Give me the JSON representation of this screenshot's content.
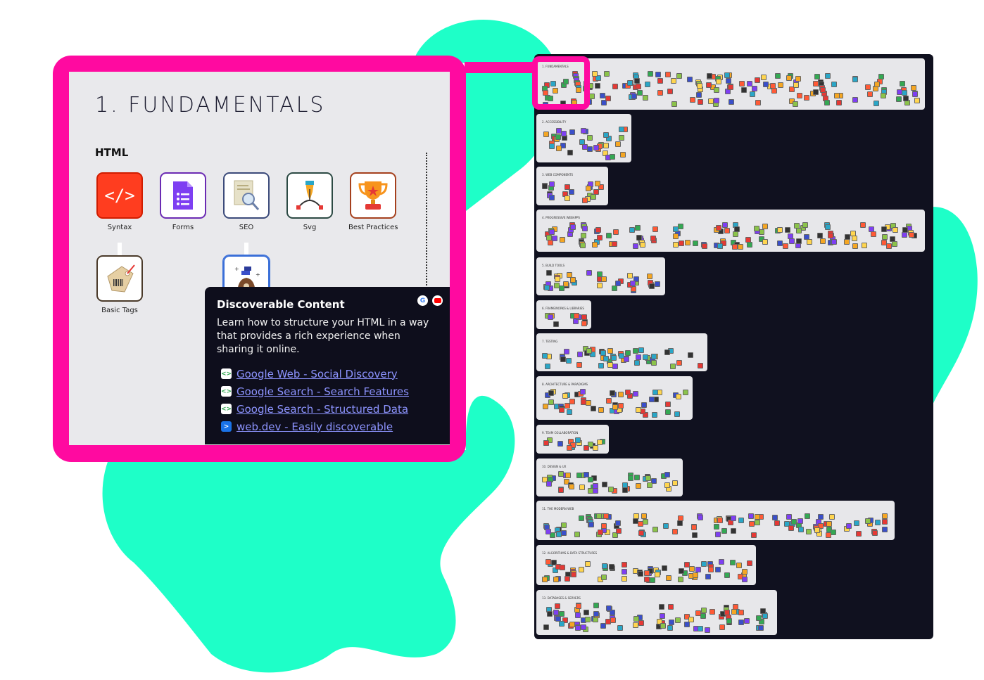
{
  "zoom": {
    "title": "1. FUNDAMENTALS",
    "section_heading": "HTML",
    "tiles": [
      {
        "label": "Syntax",
        "icon": "code-icon"
      },
      {
        "label": "Forms",
        "icon": "form-document-icon"
      },
      {
        "label": "SEO",
        "icon": "magnifier-document-icon"
      },
      {
        "label": "Svg",
        "icon": "pen-nib-icon"
      },
      {
        "label": "Best Practices",
        "icon": "trophy-icon"
      },
      {
        "label": "Basic Tags",
        "icon": "price-tag-icon"
      },
      {
        "label": "",
        "icon": "rocket-icon"
      }
    ]
  },
  "popup": {
    "title": "Discoverable Content",
    "description": "Learn how to structure your HTML in a way that provides a rich experience when sharing it online.",
    "links": [
      {
        "label": "Google Web - Social Discovery",
        "icon": "google-developers-icon"
      },
      {
        "label": "Google Search - Search Features",
        "icon": "google-developers-icon"
      },
      {
        "label": "Google Search - Structured Data",
        "icon": "google-developers-icon"
      },
      {
        "label": "web.dev - Easily discoverable",
        "icon": "web-dev-icon"
      }
    ],
    "badges": [
      "google-icon",
      "youtube-icon"
    ]
  },
  "roadmap": {
    "sections": [
      {
        "label": "1. FUNDAMENTALS"
      },
      {
        "label": "2. ACCESSIBILITY"
      },
      {
        "label": "3. WEB COMPONENTS"
      },
      {
        "label": "4. PROGRESSIVE WEBAPPS"
      },
      {
        "label": "5. BUILD TOOLS"
      },
      {
        "label": "6. FRAMEWORKS & LIBRARIES"
      },
      {
        "label": "7. TESTING"
      },
      {
        "label": "8. ARCHITECTURE & PARADIGMS"
      },
      {
        "label": "9. TEAM COLLABORATION"
      },
      {
        "label": "10. DESIGN & UX"
      },
      {
        "label": "11. THE MODERN WEB"
      },
      {
        "label": "12. ALGORITHMS & DATA STRUCTURES"
      },
      {
        "label": "13. DATABASES & SERVERS"
      }
    ]
  },
  "colors": {
    "accent_pink": "#ff0aa0",
    "blob_teal": "#1effc8",
    "dark": "#10111f",
    "link": "#8d94ff"
  }
}
